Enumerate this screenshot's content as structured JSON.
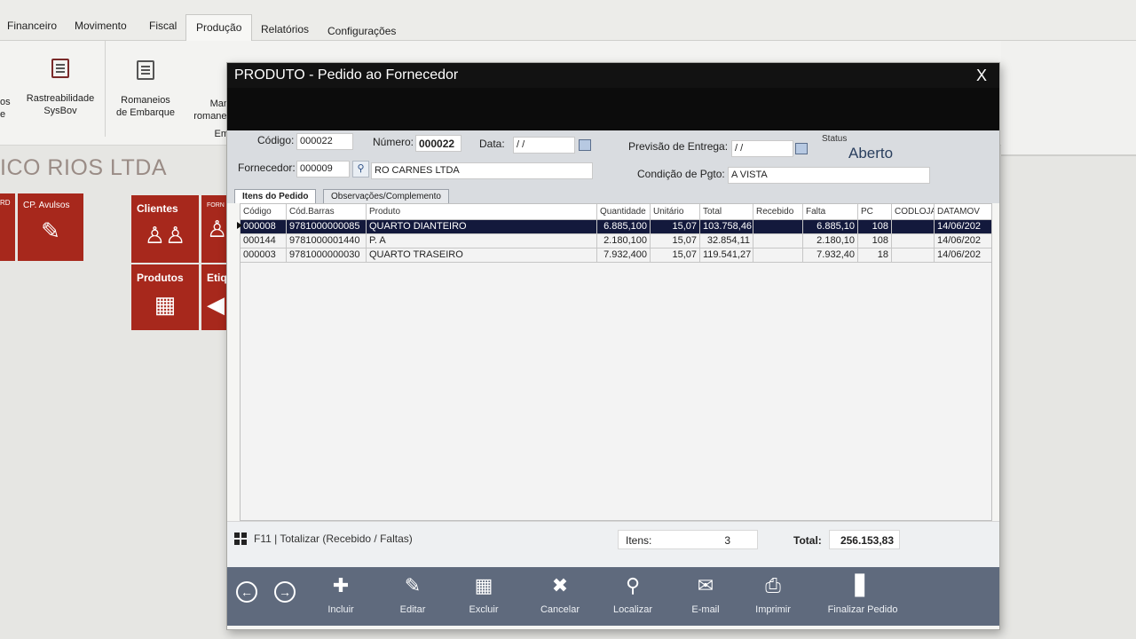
{
  "menu": [
    "Financeiro",
    "Movimento",
    "Fiscal",
    "Produção",
    "Relatórios",
    "Configurações"
  ],
  "ribbon": {
    "partial_left": [
      "os",
      "e"
    ],
    "rastreabilidade": [
      "Rastreabilidade",
      "SysBov"
    ],
    "romaneios": [
      "Romaneios",
      "de Embarque"
    ],
    "partial_right": [
      "Man",
      "romanei",
      "Em"
    ]
  },
  "company_partial": "ICO RIOS LTDA",
  "tiles": {
    "rd_partial": "RD",
    "cp_avulsos": "CP. Avulsos",
    "clientes": "Clientes",
    "forn_partial": "FORN",
    "produtos": "Produtos",
    "etiq_partial": "Etiq"
  },
  "modal": {
    "title": "PRODUTO - Pedido ao Fornecedor",
    "close": "X",
    "codigo_label": "Código:",
    "codigo": "000022",
    "numero_label": "Número:",
    "numero": "000022",
    "data_label": "Data:",
    "data": "/ /",
    "previsao_label": "Previsão de Entrega:",
    "previsao": "/ /",
    "status_label": "Status",
    "status": "Aberto",
    "fornecedor_label": "Fornecedor:",
    "fornecedor_codigo": "000009",
    "fornecedor_nome": "RO CARNES LTDA",
    "condicao_label": "Condição de Pgto:",
    "condicao": "A VISTA",
    "tabs": [
      "Itens do Pedido",
      "Observações/Complemento"
    ]
  },
  "grid": {
    "columns": [
      "Código",
      "Cód.Barras",
      "Produto",
      "Quantidade",
      "Unitário",
      "Total",
      "Recebido",
      "Falta",
      "PC",
      "CODLOJA",
      "DATAMOV"
    ],
    "rows": [
      [
        "000008",
        "9781000000085",
        "QUARTO DIANTEIRO",
        "6.885,100",
        "15,07",
        "103.758,46",
        "",
        "6.885,10",
        "108",
        "",
        "14/06/202"
      ],
      [
        "000144",
        "9781000001440",
        "P. A",
        "2.180,100",
        "15,07",
        "32.854,11",
        "",
        "2.180,10",
        "108",
        "",
        "14/06/202"
      ],
      [
        "000003",
        "9781000000030",
        "QUARTO TRASEIRO",
        "7.932,400",
        "15,07",
        "119.541,27",
        "",
        "7.932,40",
        "18",
        "",
        "14/06/202"
      ]
    ]
  },
  "summary": {
    "totalizar": "F11 | Totalizar (Recebido / Faltas)",
    "itens_label": "Itens:",
    "itens": "3",
    "total_label": "Total:",
    "total": "256.153,83"
  },
  "toolbar": [
    "Incluir",
    "Editar",
    "Excluir",
    "Cancelar",
    "Localizar",
    "E-mail",
    "Imprimir",
    "Finalizar Pedido"
  ],
  "colors": {
    "tile_red": "#a7281c",
    "toolbar": "#5f6a7d",
    "selected_row": "#13193c"
  }
}
